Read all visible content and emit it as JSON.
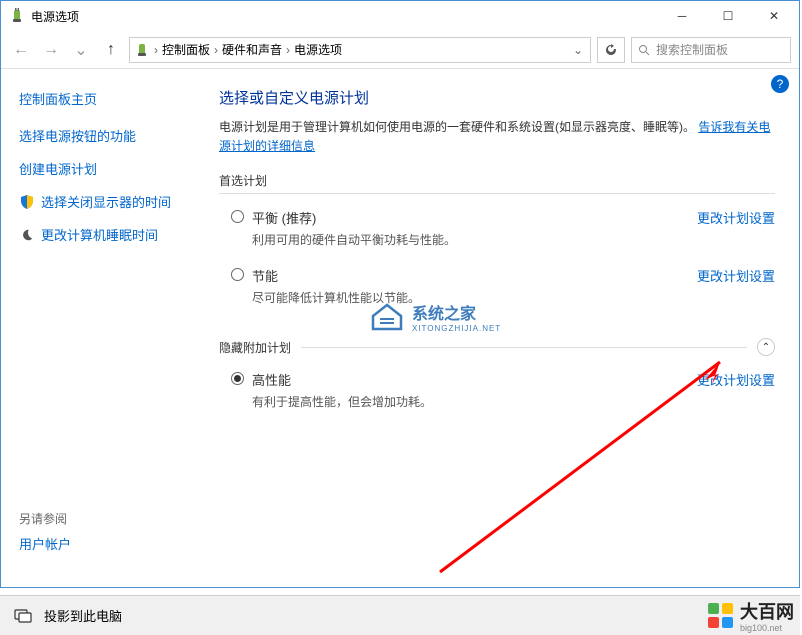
{
  "window": {
    "title": "电源选项"
  },
  "breadcrumb": {
    "seg1": "控制面板",
    "seg2": "硬件和声音",
    "seg3": "电源选项"
  },
  "search": {
    "placeholder": "搜索控制面板"
  },
  "sidebar": {
    "home": "控制面板主页",
    "links": [
      {
        "label": "选择电源按钮的功能"
      },
      {
        "label": "创建电源计划"
      },
      {
        "label": "选择关闭显示器的时间"
      },
      {
        "label": "更改计算机睡眠时间"
      }
    ],
    "also_heading": "另请参阅",
    "also_link": "用户帐户"
  },
  "main": {
    "heading": "选择或自定义电源计划",
    "desc_prefix": "电源计划是用于管理计算机如何使用电源的一套硬件和系统设置(如显示器亮度、睡眠等)。",
    "desc_link": "告诉我有关电源计划的详细信息",
    "section_preferred": "首选计划",
    "section_hidden": "隐藏附加计划",
    "change_label": "更改计划设置",
    "plans": [
      {
        "name": "平衡 (推荐)",
        "sub": "利用可用的硬件自动平衡功耗与性能。",
        "checked": false
      },
      {
        "name": "节能",
        "sub": "尽可能降低计算机性能以节能。",
        "checked": false
      }
    ],
    "hidden_plans": [
      {
        "name": "高性能",
        "sub": "有利于提高性能，但会增加功耗。",
        "checked": true
      }
    ]
  },
  "watermark": {
    "name": "系统之家",
    "sub": "XITONGZHIJIA.NET"
  },
  "taskbar": {
    "label": "投影到此电脑"
  },
  "brand": {
    "name": "大百网",
    "sub": "big100.net"
  }
}
